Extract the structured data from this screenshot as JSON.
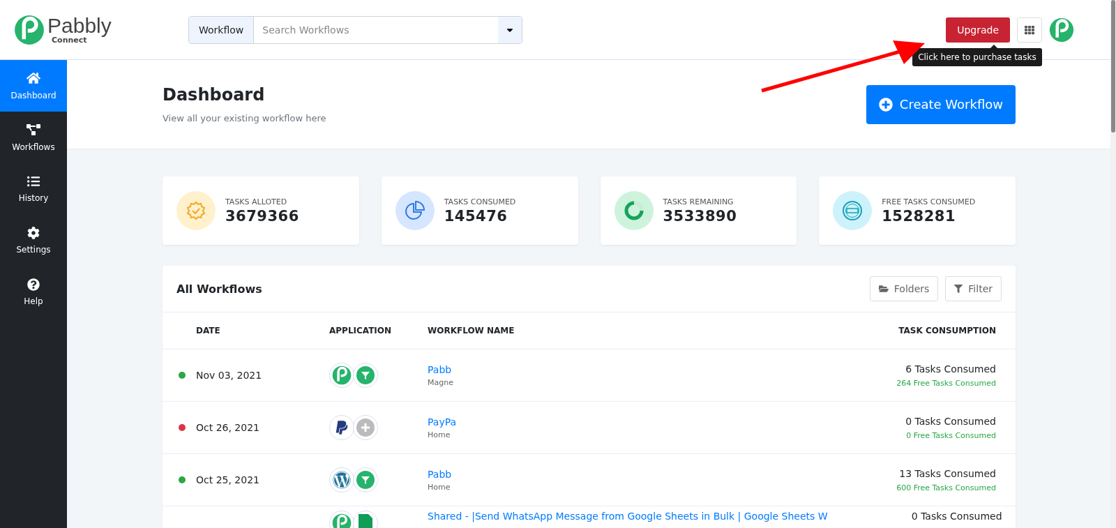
{
  "header": {
    "logo": {
      "name": "Pabbly",
      "sub": "Connect"
    },
    "search": {
      "scope": "Workflow",
      "placeholder": "Search Workflows"
    },
    "upgrade": "Upgrade",
    "tooltip": "Click here to purchase tasks"
  },
  "sidebar": {
    "items": [
      {
        "label": "Dashboard",
        "kind": "home",
        "selected": true
      },
      {
        "label": "Workflows",
        "kind": "workflow",
        "selected": false
      },
      {
        "label": "History",
        "kind": "history",
        "selected": false
      },
      {
        "label": "Settings",
        "kind": "settings",
        "selected": false
      },
      {
        "label": "Help",
        "kind": "help",
        "selected": false
      }
    ]
  },
  "page": {
    "title": "Dashboard",
    "subtitle": "View all your existing workflow here",
    "create_button": "Create Workflow"
  },
  "stats": [
    {
      "label": "TASKS ALLOTED",
      "value": "3679366",
      "kind": "badge",
      "color": "#fff1cc"
    },
    {
      "label": "TASKS CONSUMED",
      "value": "145476",
      "kind": "pie",
      "color": "#d6e6ff"
    },
    {
      "label": "TASKS REMAINING",
      "value": "3533890",
      "kind": "ring",
      "color": "#cdf3dd"
    },
    {
      "label": "FREE TASKS CONSUMED",
      "value": "1528281",
      "kind": "free",
      "color": "#cdf2fb"
    }
  ],
  "workflows": {
    "title": "All Workflows",
    "buttons": [
      "Folders",
      "Filter"
    ],
    "columns": [
      "DATE",
      "APPLICATION",
      "WORKFLOW NAME",
      "TASK CONSUMPTION"
    ],
    "rows": [
      {
        "color": "#28a745",
        "date": "Nov 03, 2021",
        "apps": [
          {
            "kind": "pabbly"
          },
          {
            "kind": "filter"
          }
        ],
        "name": "Pabb",
        "folder": "Magne",
        "tasks": "6 Tasks Consumed",
        "free_tasks": "264 Free Tasks Consumed"
      },
      {
        "color": "#dc3545",
        "date": "Oct 26, 2021",
        "apps": [
          {
            "kind": "paypal"
          },
          {
            "kind": "plus"
          }
        ],
        "name": "PayPa",
        "folder": "Home",
        "tasks": "0 Tasks Consumed",
        "free_tasks": "0 Free Tasks Consumed"
      },
      {
        "color": "#28a745",
        "date": "Oct 25, 2021",
        "apps": [
          {
            "kind": "wordpress"
          },
          {
            "kind": "filter"
          }
        ],
        "name": "Pabb",
        "folder": "Home",
        "tasks": "13 Tasks Consumed",
        "free_tasks": "600 Free Tasks Consumed"
      },
      {
        "apps": [
          {
            "kind": "pabbly"
          },
          {
            "kind": "sheets"
          }
        ],
        "name": "Shared - |Send WhatsApp Message from Google Sheets in Bulk | Google Sheets W",
        "tasks": "0 Tasks Consumed"
      }
    ]
  }
}
